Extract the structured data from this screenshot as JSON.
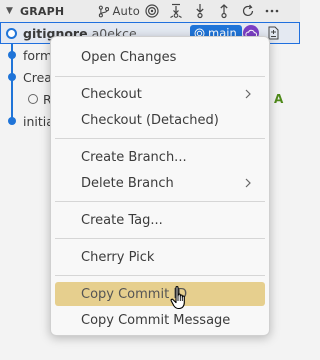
{
  "header": {
    "title": "GRAPH",
    "auto_label": "Auto"
  },
  "graph": {
    "rows": [
      {
        "message": "gitignore",
        "hash": "a0ekce",
        "selected": true
      },
      {
        "message": "form",
        "selected": false
      },
      {
        "message": "Crea",
        "selected": false
      },
      {
        "message": "R",
        "selected": false
      },
      {
        "message": "initia",
        "selected": false
      }
    ],
    "branch_badge": "main",
    "status_letter": "A"
  },
  "menu": {
    "items": [
      {
        "label": "Open Changes",
        "submenu": false
      },
      {
        "label": "Checkout",
        "submenu": true
      },
      {
        "label": "Checkout (Detached)",
        "submenu": false
      },
      {
        "label": "Create Branch...",
        "submenu": false
      },
      {
        "label": "Delete Branch",
        "submenu": true
      },
      {
        "label": "Create Tag...",
        "submenu": false
      },
      {
        "label": "Cherry Pick",
        "submenu": false
      },
      {
        "label": "Copy Commit ID",
        "submenu": false,
        "highlighted": true
      },
      {
        "label": "Copy Commit Message",
        "submenu": false
      }
    ]
  },
  "colors": {
    "accent": "#1f74d8",
    "highlight": "#e6cf8e",
    "cloud_badge": "#7b3fc4",
    "added": "#4f8a1a"
  }
}
